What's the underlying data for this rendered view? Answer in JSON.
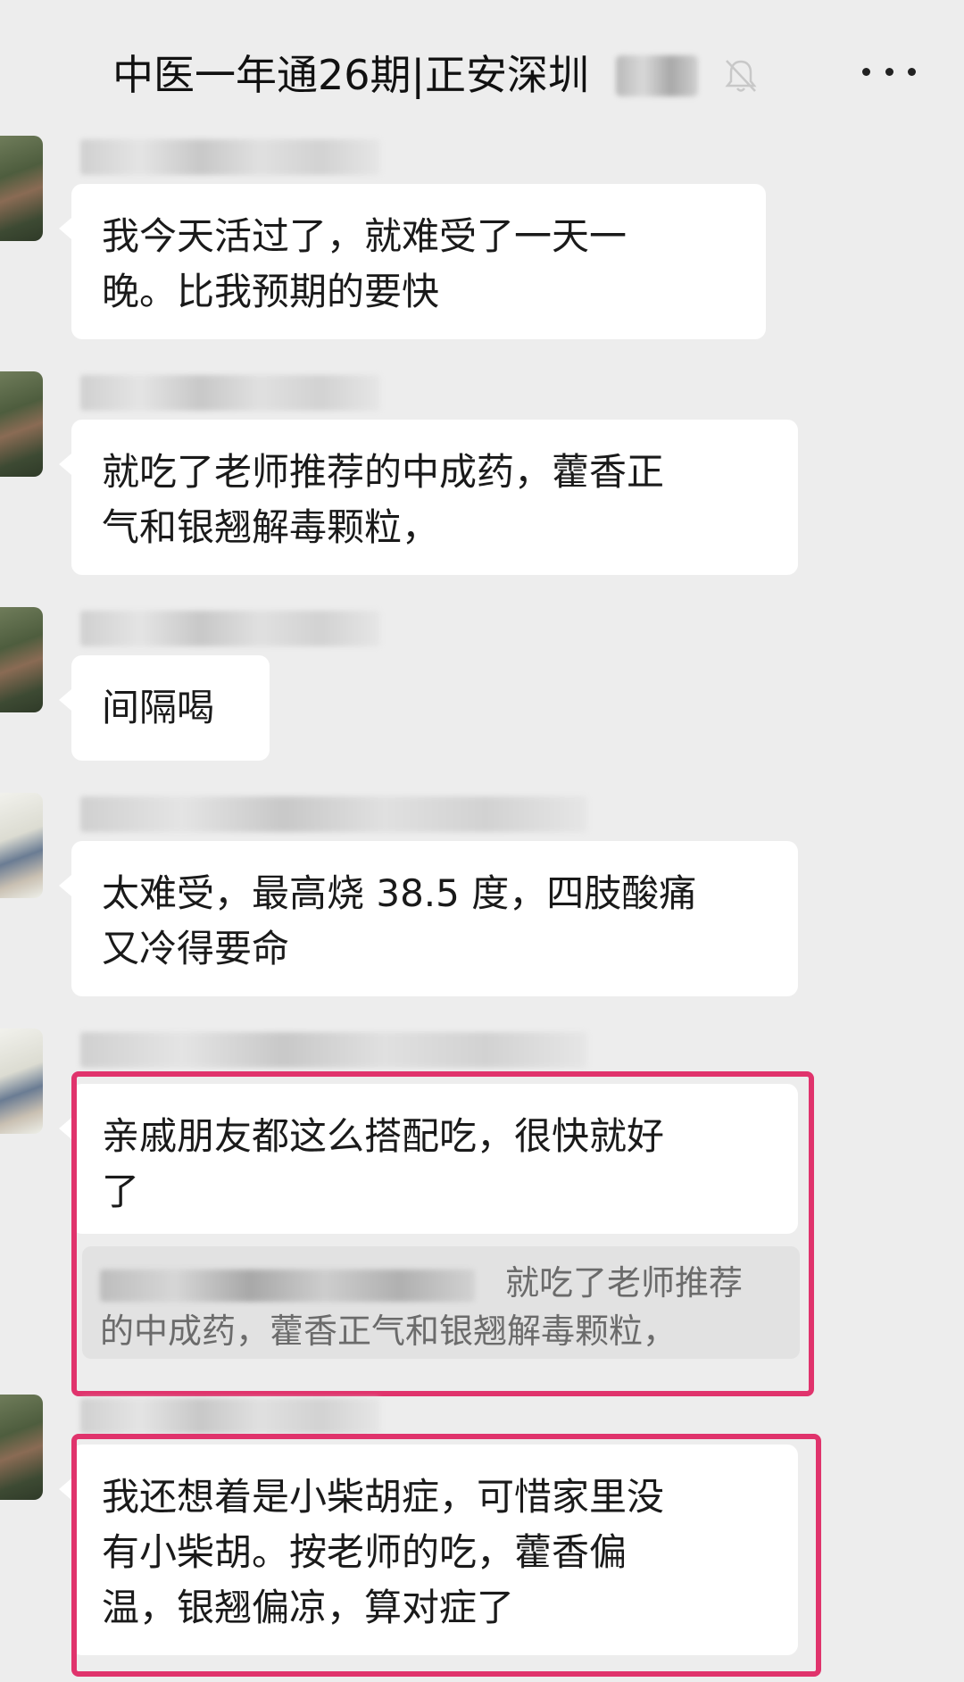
{
  "header": {
    "title": "中医一年通26期|正安深圳",
    "mute_icon": "bell-off-icon",
    "more_icon": "more-horizontal-icon"
  },
  "messages": [
    {
      "text": "我今天活过了，就难受了一天一\n晚。比我预期的要快"
    },
    {
      "text": "就吃了老师推荐的中成药，藿香正\n气和银翘解毒颗粒，"
    },
    {
      "text": "间隔喝"
    },
    {
      "text": "太难受，最高烧 38.5 度，四肢酸痛\n又冷得要命"
    },
    {
      "text": "亲戚朋友都这么搭配吃，很快就好\n了",
      "quote": "就吃了老师推荐\n的中成药，藿香正气和银翘解毒颗粒，"
    },
    {
      "text": "我还想着是小柴胡症，可惜家里没\n有小柴胡。按老师的吃，藿香偏\n温，银翘偏凉，算对症了"
    }
  ],
  "colors": {
    "highlight": "#e0336c",
    "bubble": "#ffffff",
    "background": "#ededed"
  }
}
